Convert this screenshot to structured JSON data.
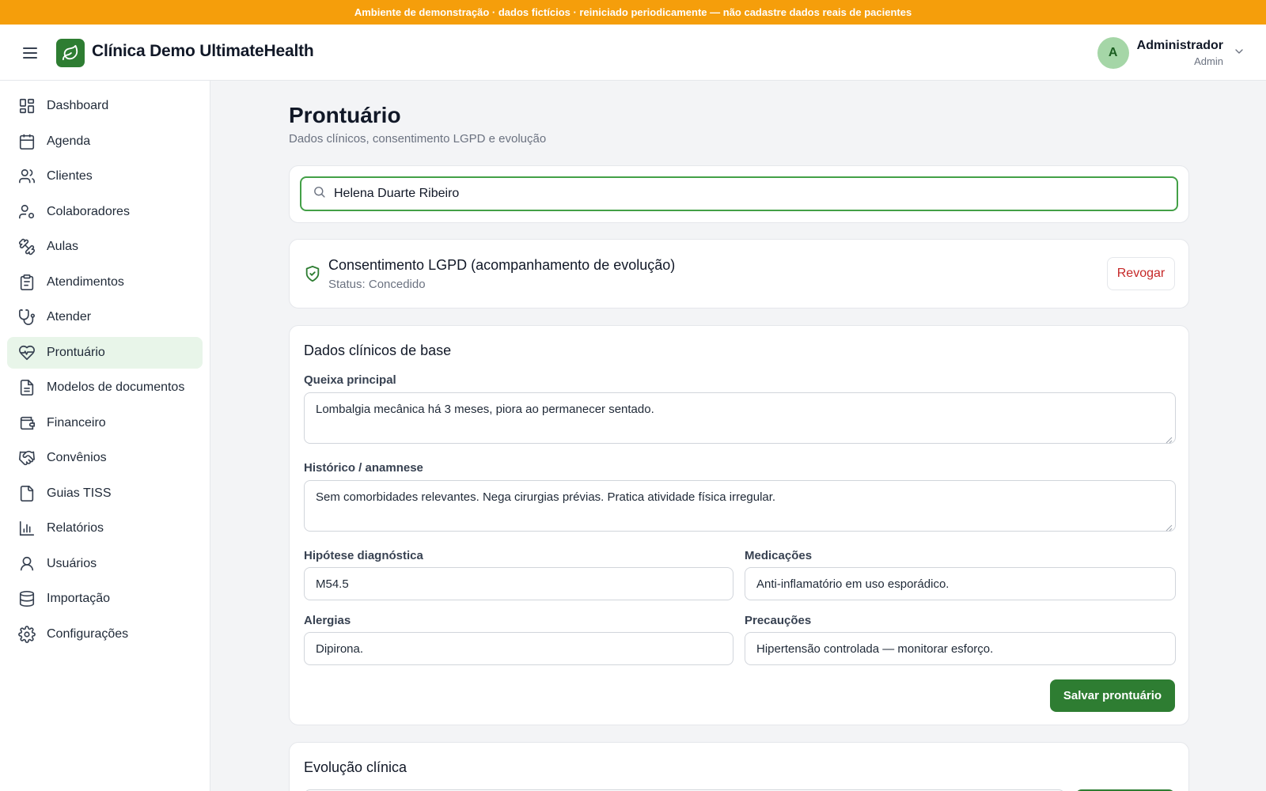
{
  "banner": {
    "text": "Ambiente de demonstração · dados fictícios · reiniciado periodicamente — não cadastre dados reais de pacientes"
  },
  "header": {
    "app_title": "Clínica Demo UltimateHealth",
    "user": {
      "initial": "A",
      "name": "Administrador",
      "role": "Admin"
    }
  },
  "sidebar": {
    "items": [
      {
        "label": "Dashboard",
        "icon": "dashboard-icon"
      },
      {
        "label": "Agenda",
        "icon": "calendar-icon"
      },
      {
        "label": "Clientes",
        "icon": "users-icon"
      },
      {
        "label": "Colaboradores",
        "icon": "user-cog-icon"
      },
      {
        "label": "Aulas",
        "icon": "dumbbell-icon"
      },
      {
        "label": "Atendimentos",
        "icon": "clipboard-icon"
      },
      {
        "label": "Atender",
        "icon": "stethoscope-icon"
      },
      {
        "label": "Prontuário",
        "icon": "heart-pulse-icon",
        "active": true
      },
      {
        "label": "Modelos de documentos",
        "icon": "file-text-icon"
      },
      {
        "label": "Financeiro",
        "icon": "wallet-icon"
      },
      {
        "label": "Convênios",
        "icon": "handshake-icon"
      },
      {
        "label": "Guias TISS",
        "icon": "file-copy-icon"
      },
      {
        "label": "Relatórios",
        "icon": "bar-chart-icon"
      },
      {
        "label": "Usuários",
        "icon": "user-icon"
      },
      {
        "label": "Importação",
        "icon": "database-icon"
      },
      {
        "label": "Configurações",
        "icon": "gear-icon"
      }
    ]
  },
  "page": {
    "title": "Prontuário",
    "subtitle": "Dados clínicos, consentimento LGPD e evolução"
  },
  "search": {
    "value": "Helena Duarte Ribeiro"
  },
  "consent": {
    "title": "Consentimento LGPD (acompanhamento de evolução)",
    "status": "Status: Concedido",
    "revoke_label": "Revogar"
  },
  "clinical": {
    "section_title": "Dados clínicos de base",
    "complaint": {
      "label": "Queixa principal",
      "value": "Lombalgia mecânica há 3 meses, piora ao permanecer sentado."
    },
    "history": {
      "label": "Histórico / anamnese",
      "value": "Sem comorbidades relevantes. Nega cirurgias prévias. Pratica atividade física irregular."
    },
    "diagnosis": {
      "label": "Hipótese diagnóstica",
      "value": "M54.5"
    },
    "medications": {
      "label": "Medicações",
      "value": "Anti-inflamatório em uso esporádico."
    },
    "allergies": {
      "label": "Alergias",
      "value": "Dipirona."
    },
    "precautions": {
      "label": "Precauções",
      "value": "Hipertensão controlada — monitorar esforço."
    },
    "save_label": "Salvar prontuário"
  },
  "evolution": {
    "section_title": "Evolução clínica"
  },
  "colors": {
    "banner": "#f59e0b",
    "brand": "#2e7d32",
    "active_bg": "#e8f5e9",
    "danger": "#c62828"
  }
}
